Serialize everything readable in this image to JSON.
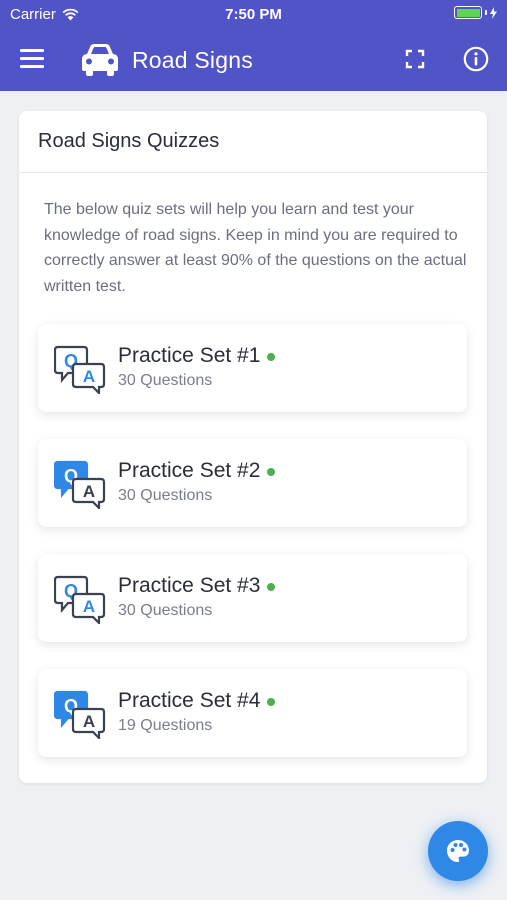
{
  "status_bar": {
    "carrier": "Carrier",
    "time": "7:50 PM",
    "wifi_icon": "wifi-icon",
    "battery_icon": "battery-icon",
    "charging_icon": "bolt-icon"
  },
  "app_bar": {
    "title": "Road Signs",
    "menu_icon": "hamburger-menu-icon",
    "logo_icon": "car-icon",
    "fullscreen_icon": "expand-icon",
    "info_icon": "info-icon",
    "color": "#5054c7"
  },
  "card": {
    "title": "Road Signs Quizzes",
    "description": "The below quiz sets will help you learn and test your knowledge of road signs. Keep in mind you are required to correctly answer at least 90% of the questions on the actual written test.",
    "sets": [
      {
        "name": "Practice Set #1",
        "count": "30 Questions",
        "icon": "qa-icon",
        "status_color": "#4caf50"
      },
      {
        "name": "Practice Set #2",
        "count": "30 Questions",
        "icon": "qa-icon",
        "status_color": "#4caf50"
      },
      {
        "name": "Practice Set #3",
        "count": "30 Questions",
        "icon": "qa-icon",
        "status_color": "#4caf50"
      },
      {
        "name": "Practice Set #4",
        "count": "19 Questions",
        "icon": "qa-icon",
        "status_color": "#4caf50"
      }
    ]
  },
  "fab": {
    "icon": "palette-icon",
    "color": "#2f87e6"
  }
}
